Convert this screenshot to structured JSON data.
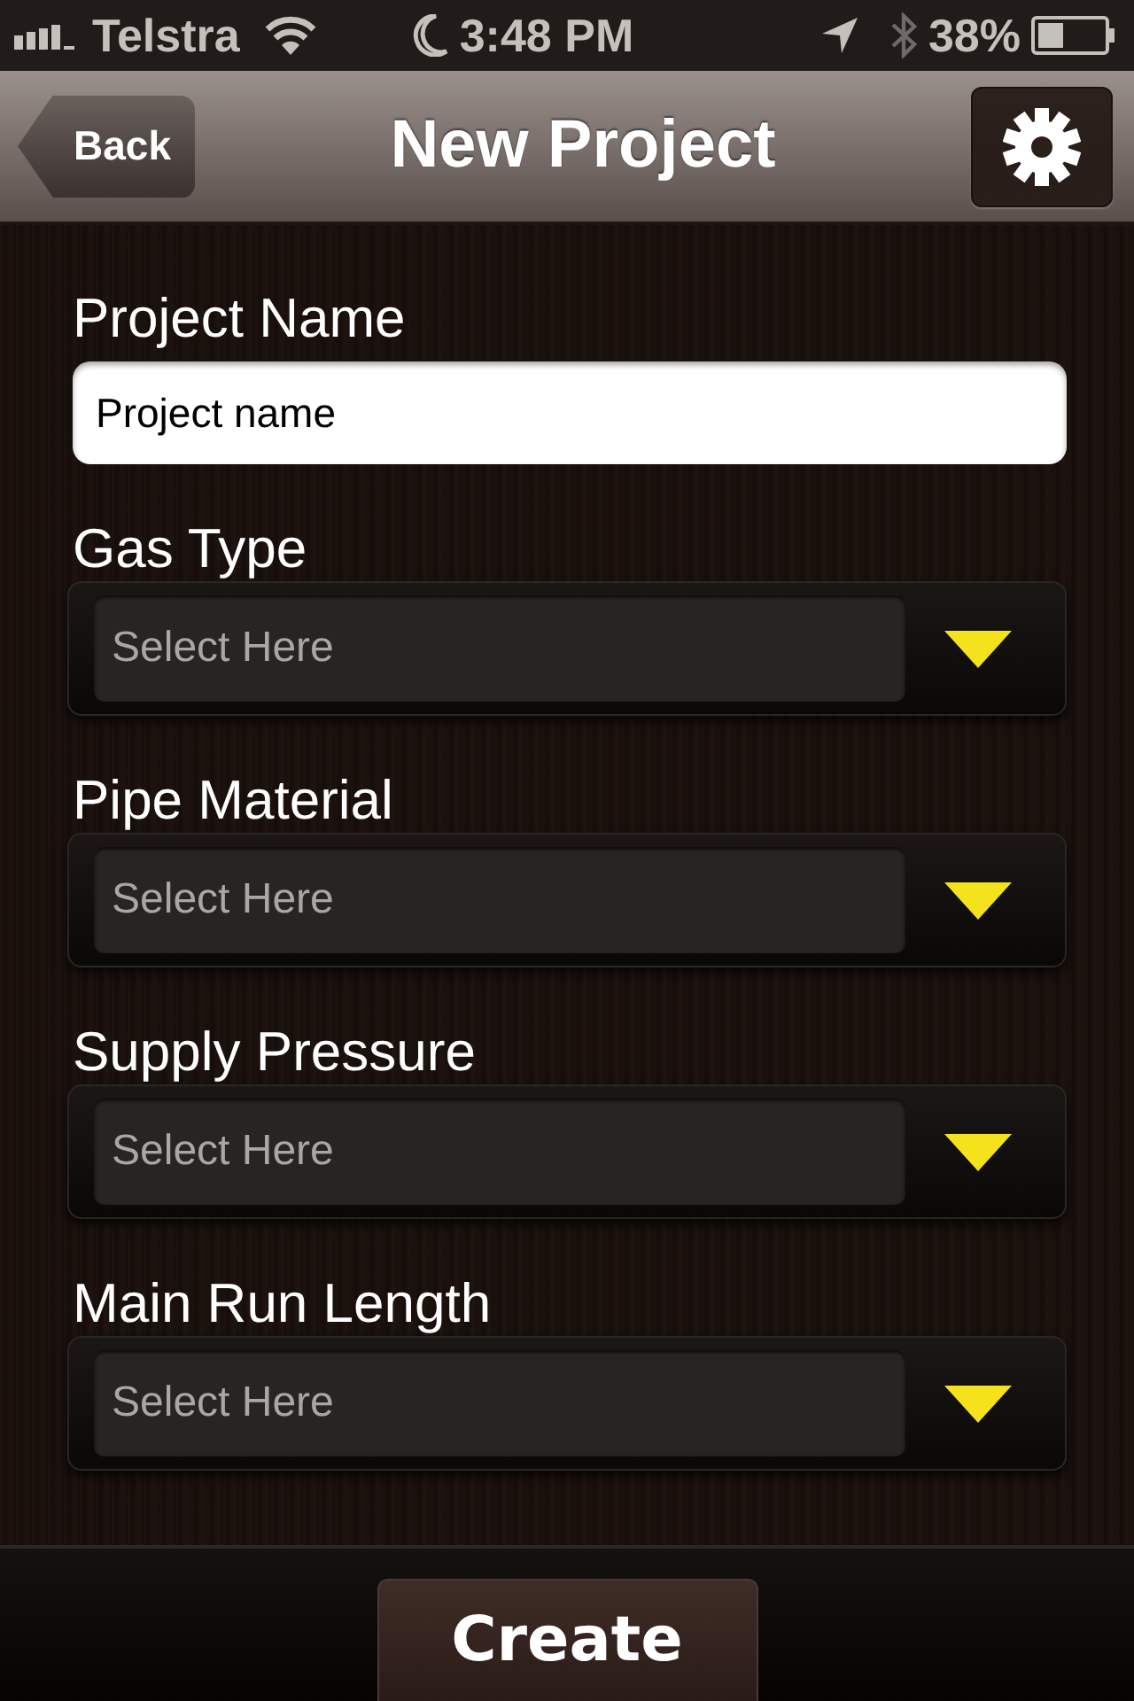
{
  "status_bar": {
    "carrier": "Telstra",
    "time": "3:48 PM",
    "battery": "38%"
  },
  "nav_bar": {
    "back": "Back",
    "title": "New Project"
  },
  "form": {
    "fields": [
      {
        "kind": "text",
        "label": "Project Name",
        "value": "Project name"
      },
      {
        "kind": "select",
        "label": "Gas Type",
        "placeholder": "Select Here"
      },
      {
        "kind": "select",
        "label": "Pipe Material",
        "placeholder": "Select Here"
      },
      {
        "kind": "select",
        "label": "Supply Pressure",
        "placeholder": "Select Here"
      },
      {
        "kind": "select",
        "label": "Main Run Length",
        "placeholder": "Select Here"
      }
    ]
  },
  "footer": {
    "button": "Create"
  }
}
